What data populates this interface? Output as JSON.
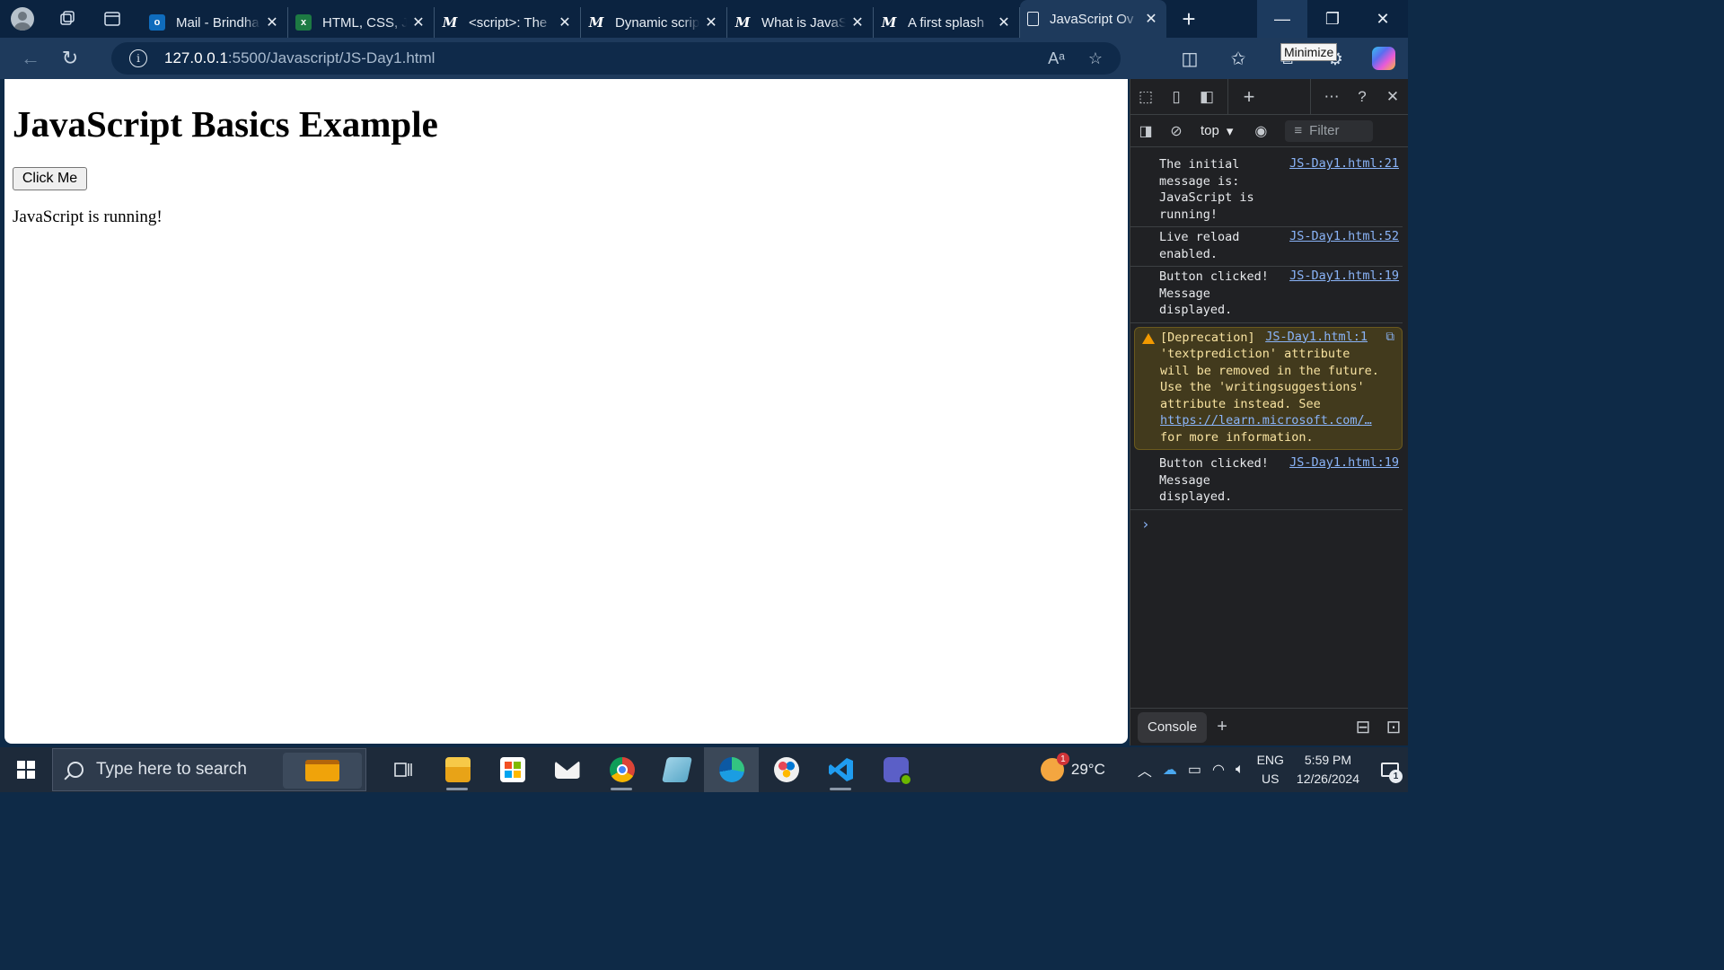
{
  "browser": {
    "tabs": [
      {
        "title": "Mail - Brindha",
        "favicon": "outlook-icon"
      },
      {
        "title": "HTML, CSS, Ja",
        "favicon": "excel-icon"
      },
      {
        "title": "<script>: The",
        "favicon": "mdn-icon"
      },
      {
        "title": "Dynamic scrip",
        "favicon": "mdn-icon"
      },
      {
        "title": "What is JavaS",
        "favicon": "mdn-icon"
      },
      {
        "title": "A first splash",
        "favicon": "mdn-icon"
      },
      {
        "title": "JavaScript Ov",
        "favicon": "page-icon",
        "active": true
      }
    ],
    "url_host": "127.0.0.1",
    "url_rest": ":5500/Javascript/JS-Day1.html",
    "tooltip": "Minimize"
  },
  "page": {
    "heading": "JavaScript Basics Example",
    "button_label": "Click Me",
    "message": "JavaScript is running!"
  },
  "devtools": {
    "context": "top",
    "filter_placeholder": "Filter",
    "drawer_tab": "Console",
    "logs": [
      {
        "text": "The initial message is: JavaScript is running!",
        "source": "JS-Day1.html:21"
      },
      {
        "text": "Live reload enabled.",
        "source": "JS-Day1.html:52"
      },
      {
        "text": "Button clicked! Message displayed.",
        "source": "JS-Day1.html:19"
      },
      {
        "warn_head": "[Deprecation] The",
        "warn_body": "'textprediction' attribute will be removed in the future. Use the 'writingsuggestions' attribute instead. See",
        "warn_link": "https://learn.microsoft.com/…",
        "warn_tail": "for more information.",
        "source": "JS-Day1.html:1"
      },
      {
        "text": "Button clicked! Message displayed.",
        "source": "JS-Day1.html:19"
      }
    ]
  },
  "taskbar": {
    "search_placeholder": "Type here to search",
    "weather_temp": "29°C",
    "weather_badge": "1",
    "lang_top": "ENG",
    "lang_bottom": "US",
    "time": "5:59 PM",
    "date": "12/26/2024",
    "notifications": "1"
  }
}
